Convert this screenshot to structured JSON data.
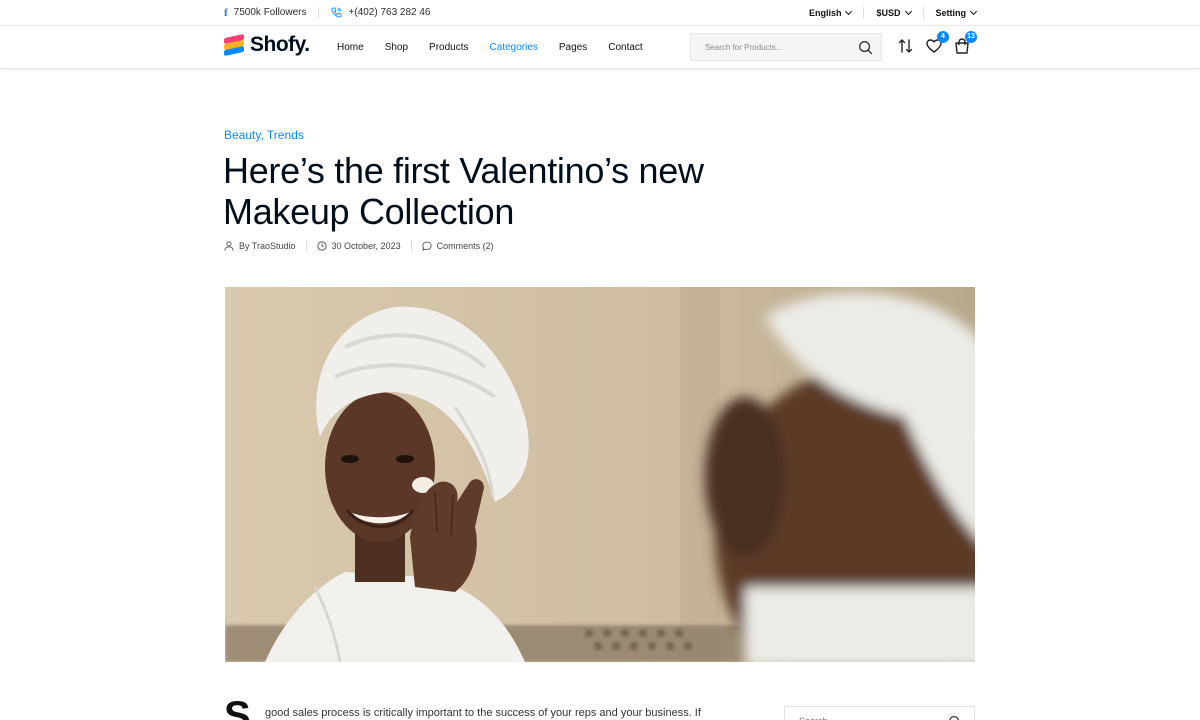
{
  "topbar": {
    "followers": "7500k Followers",
    "phone": "+(402) 763 282 46",
    "language": "English",
    "currency": "$USD",
    "setting": "Setting"
  },
  "header": {
    "logo_text": "Shofy.",
    "nav": [
      {
        "label": "Home"
      },
      {
        "label": "Shop"
      },
      {
        "label": "Products"
      },
      {
        "label": "Categories"
      },
      {
        "label": "Pages"
      },
      {
        "label": "Contact"
      }
    ],
    "search_placeholder": "Search for Products...",
    "wishlist_count": "4",
    "cart_count": "13"
  },
  "article": {
    "categories": "Beauty, Trends",
    "title": "Here’s the first Valentino’s new Makeup Collection",
    "author": "By TraoStudio",
    "date": "30 October, 2023",
    "comments": "Comments (2)",
    "dropcap": "S",
    "first_line": "good sales process is critically important to the success of your reps and your business. If"
  },
  "sidebar": {
    "search_placeholder": "Search..."
  },
  "colors": {
    "accent": "#0989ff",
    "text": "#010f1c"
  }
}
